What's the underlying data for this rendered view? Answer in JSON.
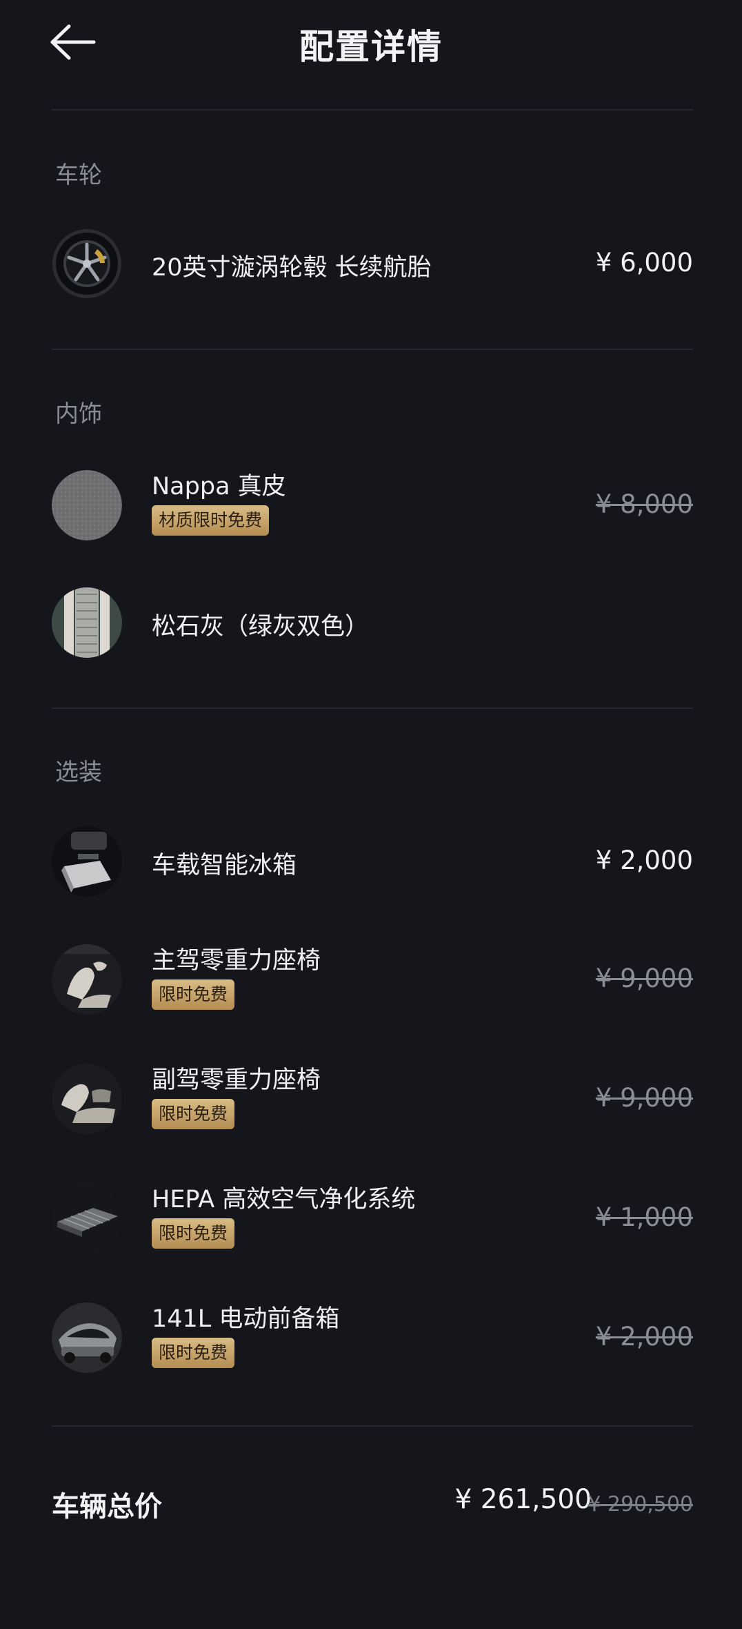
{
  "header": {
    "title": "配置详情"
  },
  "sections": {
    "wheels": {
      "title": "车轮",
      "items": [
        {
          "name": "20英寸漩涡轮毂 长续航胎",
          "price": "¥ 6,000"
        }
      ]
    },
    "interior": {
      "title": "内饰",
      "items": [
        {
          "name": "Nappa 真皮",
          "badge": "材质限时免费",
          "old_price": "¥ 8,000"
        },
        {
          "name": "松石灰（绿灰双色）"
        }
      ]
    },
    "options": {
      "title": "选装",
      "items": [
        {
          "name": "车载智能冰箱",
          "price": "¥ 2,000"
        },
        {
          "name": "主驾零重力座椅",
          "badge": "限时免费",
          "old_price": "¥ 9,000"
        },
        {
          "name": "副驾零重力座椅",
          "badge": "限时免费",
          "old_price": "¥ 9,000"
        },
        {
          "name": "HEPA 高效空气净化系统",
          "badge": "限时免费",
          "old_price": "¥ 1,000"
        },
        {
          "name": "141L 电动前备箱",
          "badge": "限时免费",
          "old_price": "¥ 2,000"
        }
      ]
    }
  },
  "total": {
    "label": "车辆总价",
    "price": "¥ 261,500",
    "old_price": "¥ 290,500"
  },
  "colors": {
    "background": "#14161c",
    "badge_gold": "#c9a86b",
    "muted_text": "#8a8d95"
  },
  "icons": [
    "back-arrow-icon"
  ]
}
